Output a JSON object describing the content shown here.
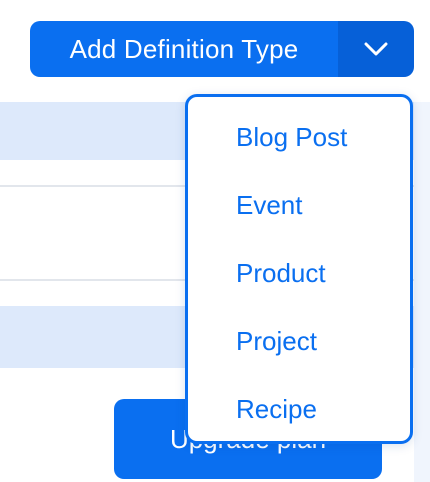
{
  "split_button": {
    "label": "Add Definition Type"
  },
  "dropdown": {
    "items": [
      {
        "label": "Blog Post"
      },
      {
        "label": "Event"
      },
      {
        "label": "Product"
      },
      {
        "label": "Project"
      },
      {
        "label": "Recipe"
      }
    ]
  },
  "upgrade_button": {
    "label": "Upgrade plan"
  },
  "colors": {
    "primary": "#0a6ff0",
    "primary_dark": "#0660d8",
    "band": "#dde9fb",
    "divider": "#e2e6ec"
  },
  "icons": {
    "toggle": "chevron-down-icon"
  }
}
